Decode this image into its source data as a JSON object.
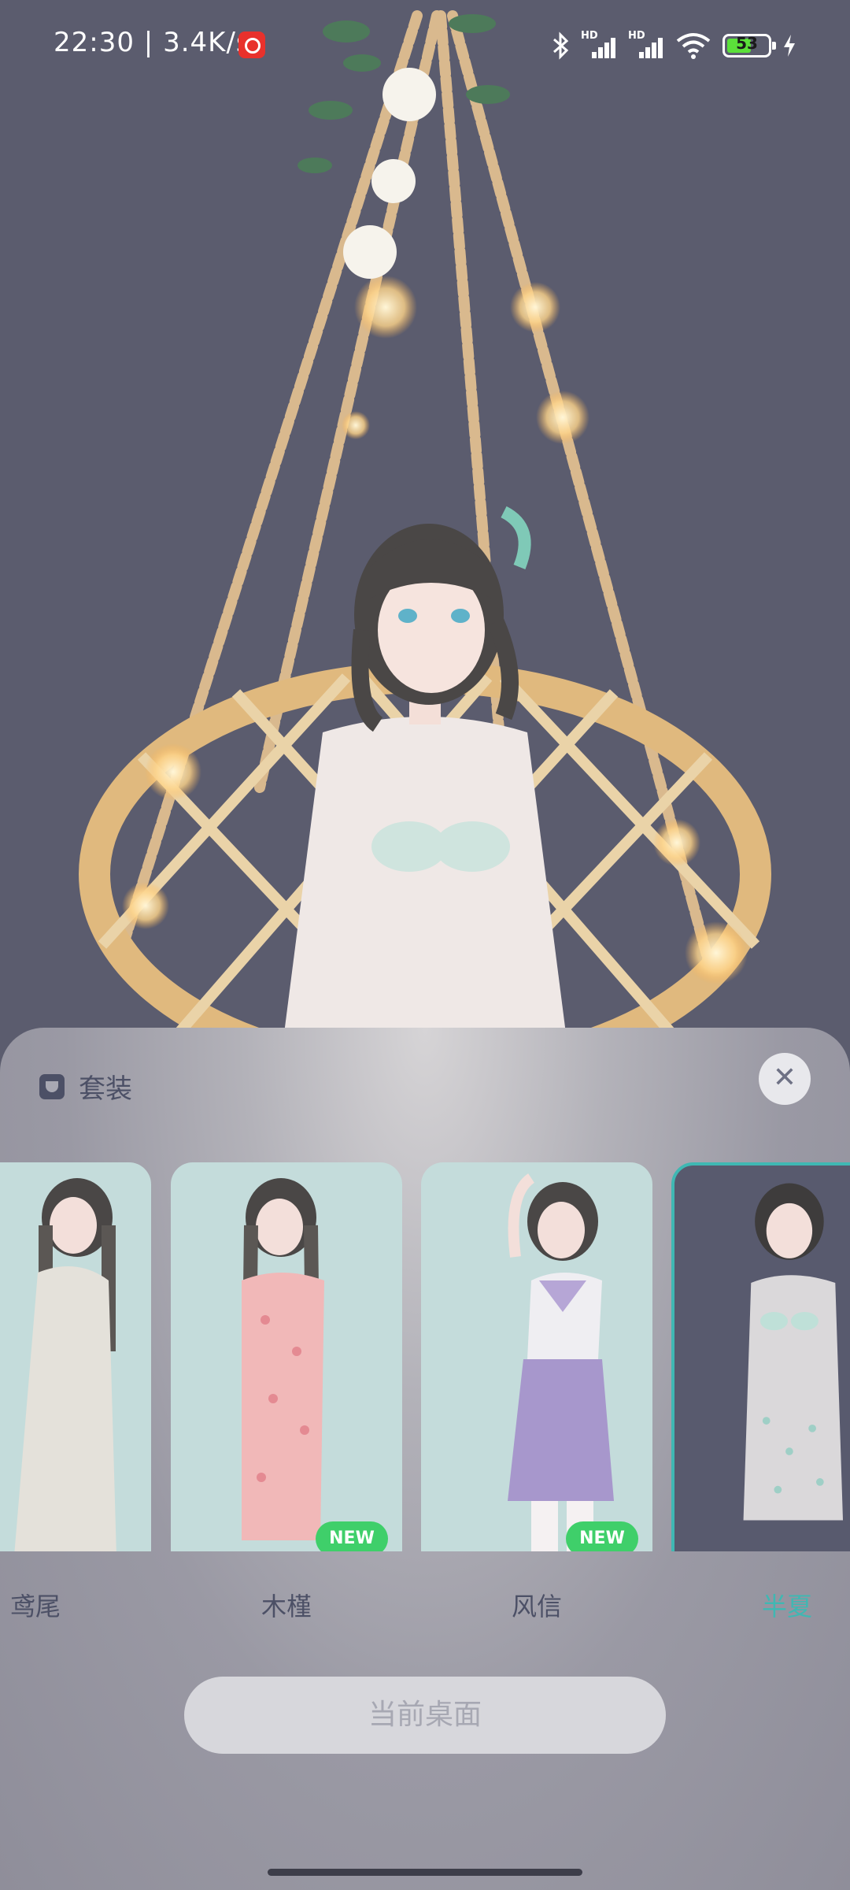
{
  "status_bar": {
    "time": "22:30",
    "separator": "|",
    "network_speed": "3.4K/s",
    "app_icon": "netease-music-icon",
    "sim1_label": "HD",
    "sim2_label": "HD",
    "battery_percent": "53",
    "icons": [
      "bluetooth-icon",
      "signal-icon",
      "signal-icon",
      "wifi-icon",
      "battery-icon",
      "charging-icon"
    ]
  },
  "sheet": {
    "title": "套装",
    "title_icon": "shirt-icon",
    "close_glyph": "✕"
  },
  "outfits": [
    {
      "name": "鸢尾",
      "badge": "",
      "selected": false
    },
    {
      "name": "木槿",
      "badge": "NEW",
      "selected": false
    },
    {
      "name": "风信",
      "badge": "NEW",
      "selected": false
    },
    {
      "name": "半夏",
      "badge": "",
      "selected": true
    }
  ],
  "apply_button": {
    "label": "当前桌面"
  },
  "colors": {
    "background": "#5b5c6e",
    "accent": "#3fb8b3",
    "new_badge": "#3fcf6a",
    "card_bg": "#c4dcdb",
    "text": "#4c5066"
  }
}
